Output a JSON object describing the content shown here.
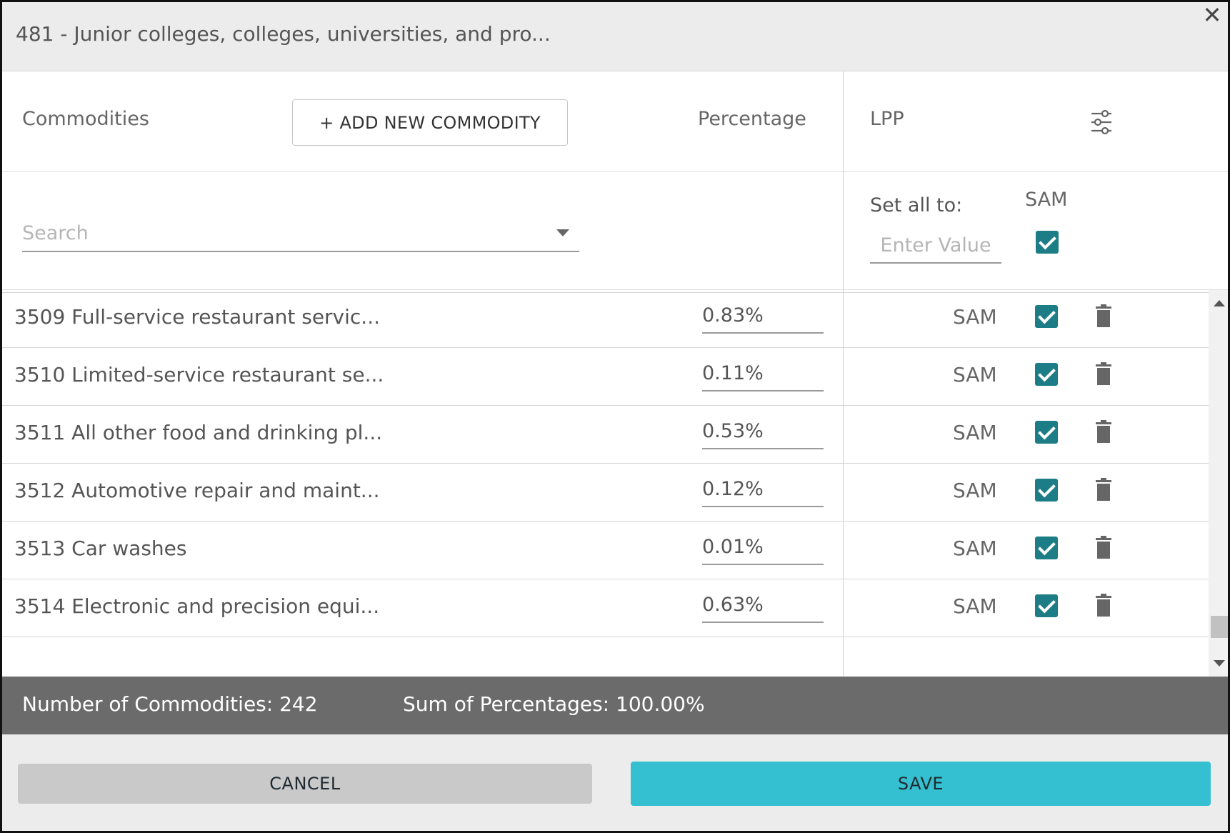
{
  "dialog": {
    "title": "481 - Junior colleges, colleges, universities, and pro...",
    "close_glyph": "✕"
  },
  "header": {
    "commodities_label": "Commodities",
    "add_button_label": "+ ADD NEW COMMODITY",
    "percentage_label": "Percentage",
    "lpp_label": "LPP"
  },
  "filters": {
    "search_placeholder": "Search",
    "set_all_label": "Set all to:",
    "enter_value_placeholder": "Enter Value",
    "sam_label": "SAM",
    "sam_checked": true
  },
  "rows": [
    {
      "name": "3509 Full-service restaurant servic...",
      "percentage": "0.83%",
      "source": "SAM",
      "checked": true
    },
    {
      "name": "3510 Limited-service restaurant se...",
      "percentage": "0.11%",
      "source": "SAM",
      "checked": true
    },
    {
      "name": "3511 All other food and drinking pl...",
      "percentage": "0.53%",
      "source": "SAM",
      "checked": true
    },
    {
      "name": "3512 Automotive repair and maint...",
      "percentage": "0.12%",
      "source": "SAM",
      "checked": true
    },
    {
      "name": "3513 Car washes",
      "percentage": "0.01%",
      "source": "SAM",
      "checked": true
    },
    {
      "name": "3514 Electronic and precision equi...",
      "percentage": "0.63%",
      "source": "SAM",
      "checked": true
    }
  ],
  "summary": {
    "count_text": "Number of Commodities: 242",
    "sum_text": "Sum of Percentages: 100.00%"
  },
  "footer": {
    "cancel_label": "CANCEL",
    "save_label": "SAVE"
  },
  "colors": {
    "checkbox": "#1d7d86",
    "save_button": "#34c0d0",
    "summary_bar": "#6b6b6b"
  }
}
